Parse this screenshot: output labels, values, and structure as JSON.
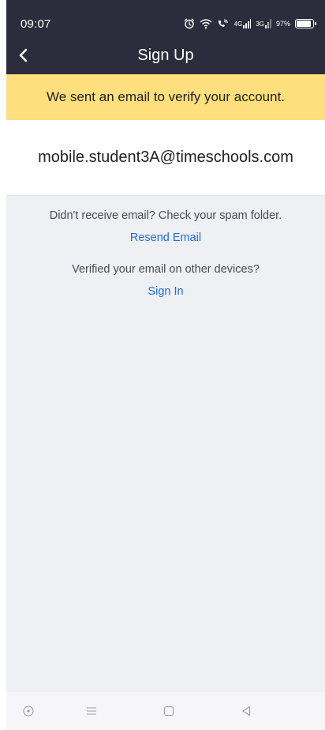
{
  "status_bar": {
    "time": "09:07",
    "signal_label_4g": "4G",
    "signal_label_3g": "3G",
    "battery_text": "97%",
    "battery_level": 0.97
  },
  "nav": {
    "title": "Sign Up",
    "back_icon": "chevron-left-icon"
  },
  "banner": {
    "text": "We sent an email to verify your account."
  },
  "email": {
    "address": "mobile.student3A@timeschools.com"
  },
  "resend": {
    "prompt": "Didn't receive email? Check your spam folder.",
    "link": "Resend Email"
  },
  "signin": {
    "prompt": "Verified your email on other devices?",
    "link": "Sign In"
  },
  "system_nav": {
    "icons": [
      "accessibility-icon",
      "menu-icon",
      "home-icon",
      "back-icon"
    ]
  },
  "colors": {
    "header_bg": "#2d2c3c",
    "banner_bg": "#fde07d",
    "link": "#1f6fd1",
    "page_bg": "#eff0f4"
  }
}
